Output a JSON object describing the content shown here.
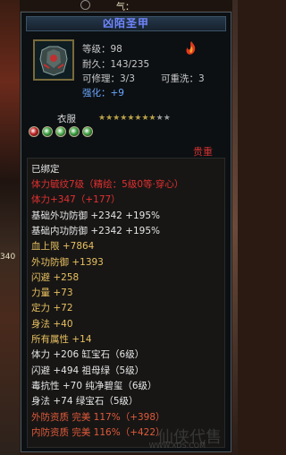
{
  "hud": {
    "qi_label": "气："
  },
  "side": {
    "num1": "340"
  },
  "item": {
    "name": "凶陌圣甲",
    "level_label": "等级：98",
    "durability_label": "耐久：143/235",
    "repair_label": "可修理：3/3",
    "rewash_label": "可重洗：3",
    "enhance_label": "强化：+9",
    "type_label": "衣服",
    "stars": {
      "total": 10,
      "filled": 8
    },
    "binding": "贵重",
    "bound_label": "已绑定"
  },
  "stats": [
    {
      "text": "体力毓纹7级（精绘：5级0等·穿心）",
      "color": "red"
    },
    {
      "text": "体力+347（+177）",
      "color": "red"
    },
    {
      "text": "基础外功防御 +2342 +195%",
      "color": "white"
    },
    {
      "text": "基础内功防御 +2342 +195%",
      "color": "white"
    },
    {
      "text": "血上限 +7864",
      "color": "yellow"
    },
    {
      "text": "外功防御 +1393",
      "color": "yellow"
    },
    {
      "text": "闪避 +258",
      "color": "yellow"
    },
    {
      "text": "力量 +73",
      "color": "yellow"
    },
    {
      "text": "定力 +72",
      "color": "yellow"
    },
    {
      "text": "身法 +40",
      "color": "yellow"
    },
    {
      "text": "所有属性 +14",
      "color": "yellow"
    },
    {
      "text": "体力 +206 缸宝石（6级）",
      "color": "white"
    },
    {
      "text": "闪避 +494 祖母绿（5级）",
      "color": "white"
    },
    {
      "text": "毒抗性 +70 纯净碧玺（6级）",
      "color": "white"
    },
    {
      "text": "身法 +74 绿宝石（5级）",
      "color": "white"
    },
    {
      "text": "外防资质  完美 117%（+398）",
      "color": "lightred"
    },
    {
      "text": "内防资质  完美 116%（+422）",
      "color": "lightred"
    }
  ],
  "watermark": {
    "main": "仙侠代售",
    "sub": "WWW.XDS.COM"
  },
  "colors": {
    "title": "#6f86ff",
    "red": "#e23030",
    "yellow": "#e8c060",
    "blue": "#5f8cff",
    "white": "#e6e6e6"
  },
  "gems": [
    "#c02020",
    "#3aa040",
    "#50b050",
    "#3aa040",
    "#40a040"
  ]
}
